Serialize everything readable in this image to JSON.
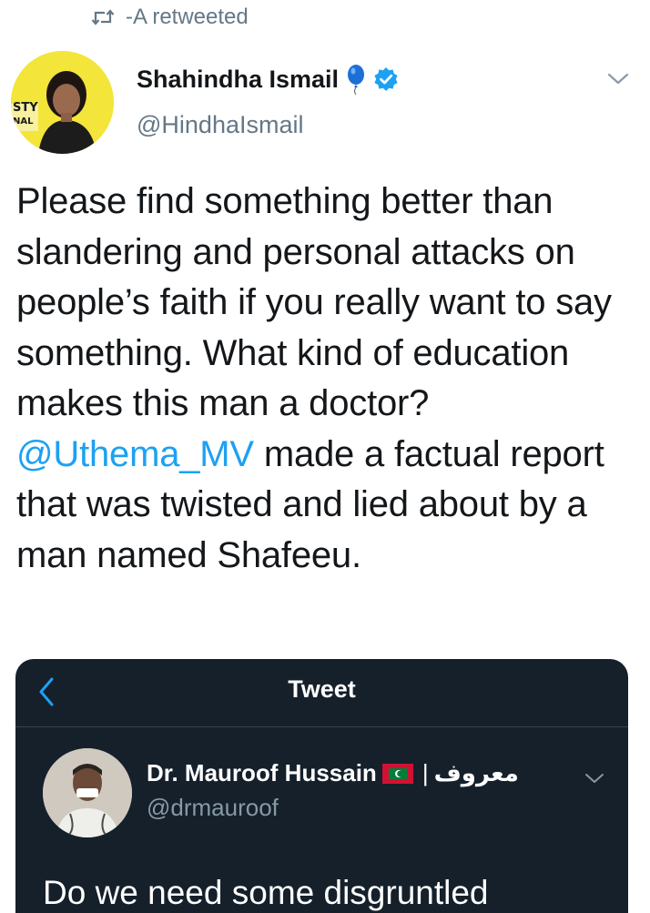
{
  "retweet": {
    "icon": "retweet-icon",
    "label": "-A retweeted"
  },
  "author": {
    "name": "Shahindha Ismail",
    "handle": "@HindhaIsmail",
    "badges": [
      "balloon-pin-icon",
      "verified-icon"
    ],
    "avatar_text": [
      "STY",
      "NAL"
    ]
  },
  "tweet": {
    "segments": [
      "Please find something better than slandering and personal attacks on people’s faith if you really want to say something. What kind of education makes this man a doctor? ",
      "@Uthema_MV",
      " made a factual report that was twisted and lied about by a man named Shafeeu."
    ]
  },
  "embedded_screenshot": {
    "header_title": "Tweet",
    "author_name": "Dr. Mauroof Hussain",
    "author_separator": "|",
    "author_arabic": "معروف",
    "author_handle": "@drmauroof",
    "text": "Do we need some disgruntled"
  },
  "colors": {
    "accent": "#1da1f2",
    "text": "#14171a",
    "muted": "#657786",
    "embed_background": "#15202b"
  }
}
